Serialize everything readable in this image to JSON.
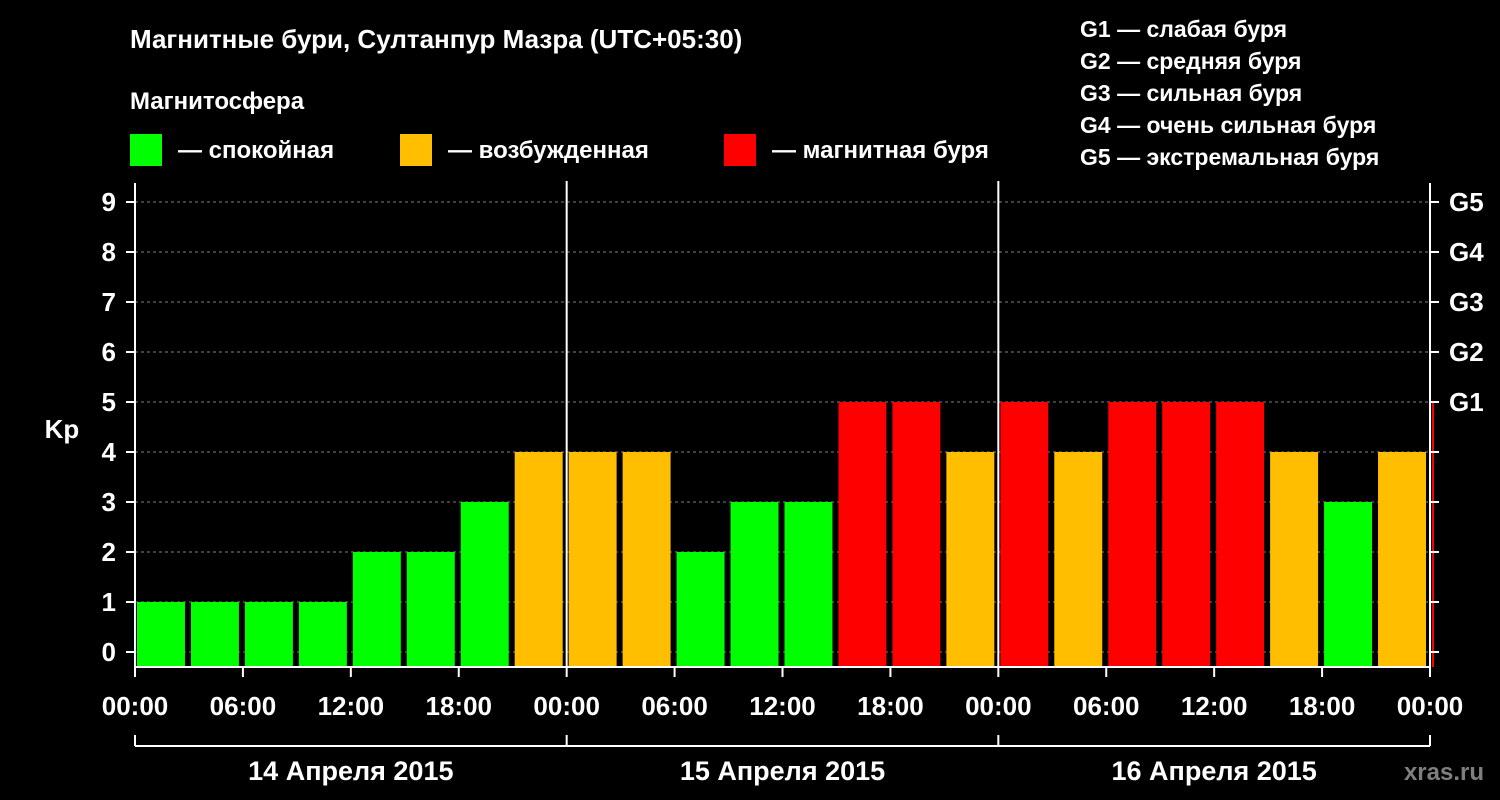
{
  "title": "Магнитные бури, Султанпур Мазра (UTC+05:30)",
  "legend": {
    "heading": "Магнитосфера",
    "items": [
      {
        "label": "— спокойная",
        "color": "#00ff00"
      },
      {
        "label": "— возбужденная",
        "color": "#ffbf00"
      },
      {
        "label": "— магнитная буря",
        "color": "#ff0000"
      }
    ],
    "storm_levels": [
      "G1 — слабая буря",
      "G2 — средняя буря",
      "G3 — сильная буря",
      "G4 — очень сильная буря",
      "G5 — экстремальная буря"
    ]
  },
  "watermark": "xras.ru",
  "chart_data": {
    "type": "bar",
    "ylabel": "Kp",
    "ylim": [
      0,
      9
    ],
    "y_ticks": [
      "0",
      "1",
      "2",
      "3",
      "4",
      "5",
      "6",
      "7",
      "8",
      "9"
    ],
    "right_ticks": [
      {
        "value": 5,
        "label": "G1"
      },
      {
        "value": 6,
        "label": "G2"
      },
      {
        "value": 7,
        "label": "G3"
      },
      {
        "value": 8,
        "label": "G4"
      },
      {
        "value": 9,
        "label": "G5"
      }
    ],
    "x_ticks": [
      "00:00",
      "06:00",
      "12:00",
      "18:00",
      "00:00",
      "06:00",
      "12:00",
      "18:00",
      "00:00",
      "06:00",
      "12:00",
      "18:00",
      "00:00"
    ],
    "days": [
      "14 Апреля 2015",
      "15 Апреля 2015",
      "16 Апреля 2015"
    ],
    "interval_hours": 3,
    "values": [
      1,
      1,
      1,
      1,
      2,
      2,
      3,
      4,
      4,
      4,
      2,
      3,
      3,
      5,
      5,
      4,
      5,
      4,
      5,
      5,
      5,
      4,
      3,
      4,
      5
    ],
    "colors": {
      "quiet": "#00ff00",
      "unsettled": "#ffbf00",
      "storm": "#ff0000"
    },
    "grid": "dashed"
  }
}
